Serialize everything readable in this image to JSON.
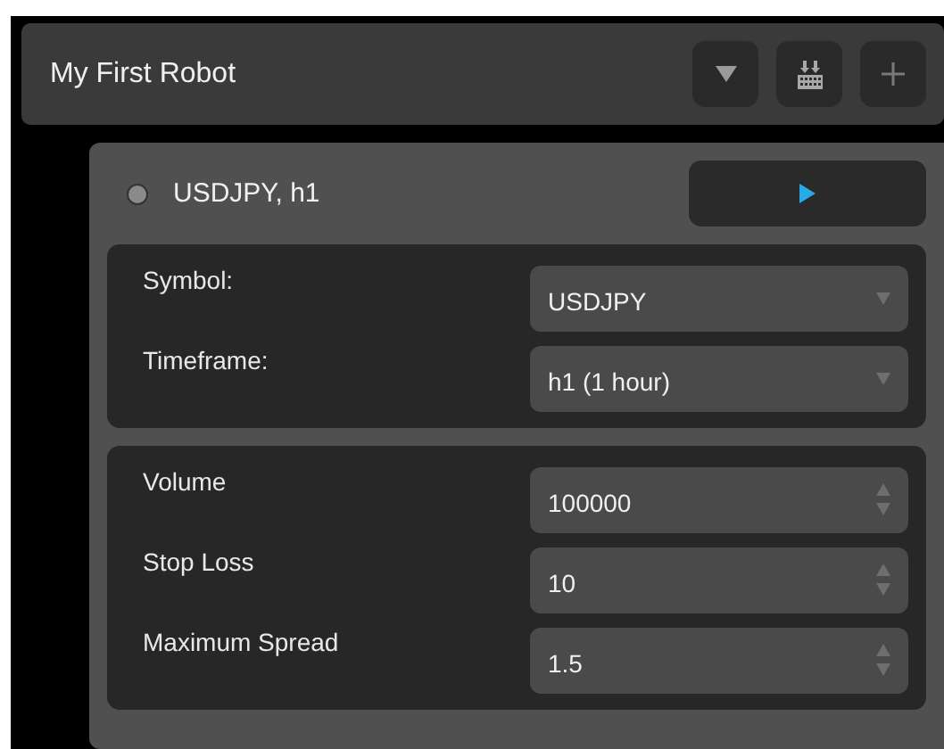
{
  "robot": {
    "title": "My First Robot"
  },
  "instance": {
    "title": "USDJPY, h1",
    "running": false
  },
  "selects": [
    {
      "label": "Symbol:",
      "value": "USDJPY"
    },
    {
      "label": "Timeframe:",
      "value": "h1 (1 hour)"
    }
  ],
  "parameters": [
    {
      "label": "Volume",
      "value": "100000"
    },
    {
      "label": "Stop Loss",
      "value": "10"
    },
    {
      "label": "Maximum Spread",
      "value": "1.5"
    }
  ]
}
